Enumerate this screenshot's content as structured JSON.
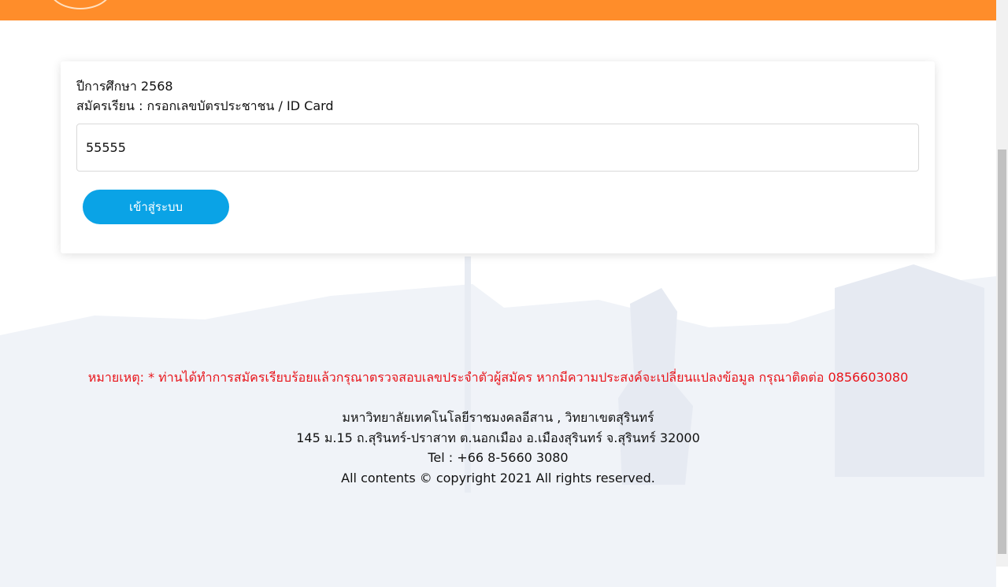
{
  "header": {
    "background": "#ff8d2a"
  },
  "card": {
    "year_line": "ปีการศึกษา 2568",
    "prompt_line": "สมัครเรียน : กรอกเลขบัตรประชาชน / ID Card",
    "id_input_value": "55555",
    "login_label": "เข้าสู่ระบบ"
  },
  "note": {
    "text": "หมายเหตุ: * ท่านได้ทำการสมัครเรียบร้อยแล้วกรุณาตรวจสอบเลขประจำตัวผู้สมัคร หากมีความประสงค์จะเปลี่ยนแปลงข้อมูล กรุณาติดต่อ 0856603080",
    "color": "#e8141a"
  },
  "footer": {
    "institution": "มหาวิทยาลัยเทคโนโลยีราชมงคลอีสาน , วิทยาเขตสุรินทร์",
    "address": "145 ม.15 ถ.สุรินทร์-ปราสาท ต.นอกเมือง อ.เมืองสุรินทร์ จ.สุรินทร์ 32000",
    "tel": "Tel : +66 8-5660 3080",
    "copyright": "All contents © copyright 2021 All rights reserved."
  },
  "colors": {
    "accent": "#ff8d2a",
    "button": "#0aa3e6"
  }
}
